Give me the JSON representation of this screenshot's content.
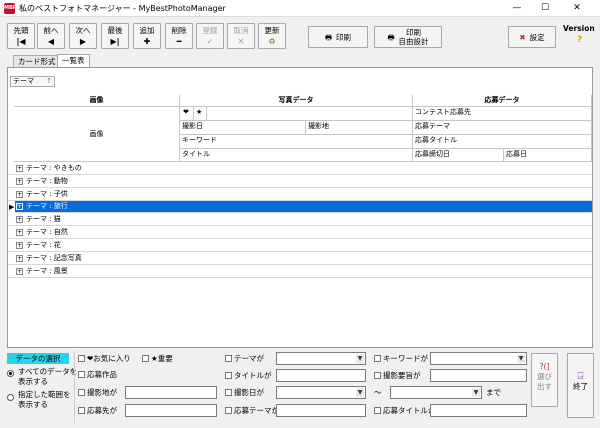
{
  "window": {
    "title": "私のベストフォトマネージャー - MyBestPhotoManager",
    "minimize": "—",
    "maximize": "☐",
    "close": "✕"
  },
  "toolbar": {
    "buttons": [
      {
        "label": "先頭",
        "icon": "|◀",
        "enabled": true
      },
      {
        "label": "前へ",
        "icon": "◀",
        "enabled": true
      },
      {
        "label": "次へ",
        "icon": "▶",
        "enabled": true
      },
      {
        "label": "最後",
        "icon": "▶|",
        "enabled": true
      },
      {
        "label": "追加",
        "icon": "✚",
        "enabled": true
      },
      {
        "label": "削除",
        "icon": "━",
        "enabled": true
      },
      {
        "label": "登録",
        "icon": "✓",
        "enabled": false
      },
      {
        "label": "取消",
        "icon": "✕",
        "enabled": false
      },
      {
        "label": "更新",
        "icon": "♻",
        "enabled": true
      }
    ],
    "print": "印刷",
    "print_custom_1": "印刷",
    "print_custom_2": "自由設計",
    "settings": "設定",
    "version": "Version",
    "version_icon": "?"
  },
  "tabs": [
    "カード形式",
    "一覧表"
  ],
  "group_by": "テーマ",
  "grid": {
    "col_image": "画像",
    "col_photo": "写真データ",
    "col_contest": "応募データ",
    "image_label": "画像",
    "heart": "❤",
    "star": "★",
    "contest_dest": "コンテスト応募先",
    "shot_date": "撮影日",
    "shot_place": "撮影地",
    "apply_theme": "応募テーマ",
    "keyword": "キーワード",
    "apply_title": "応募タイトル",
    "title": "タイトル",
    "deadline": "応募締切日",
    "apply_date": "応募日"
  },
  "rows": [
    {
      "label": "テーマ : やきもの",
      "selected": false
    },
    {
      "label": "テーマ : 動物",
      "selected": false
    },
    {
      "label": "テーマ : 子供",
      "selected": false
    },
    {
      "label": "テーマ : 旅行",
      "selected": true
    },
    {
      "label": "テーマ : 猫",
      "selected": false
    },
    {
      "label": "テーマ : 自然",
      "selected": false
    },
    {
      "label": "テーマ : 花",
      "selected": false
    },
    {
      "label": "テーマ : 記念写真",
      "selected": false
    },
    {
      "label": "テーマ : 風景",
      "selected": false
    }
  ],
  "filter": {
    "header": "データの選択",
    "radio_all_1": "すべてのデータを",
    "radio_all_2": "表示する",
    "radio_range_1": "指定した範囲を",
    "radio_range_2": "表示する",
    "fav": "❤お気に入り",
    "important": "★重要",
    "theme": "テーマが",
    "keyword": "キーワードが",
    "entry": "応募作品",
    "title": "タイトルが",
    "requirement": "撮影要旨が",
    "shot_place": "撮影地が",
    "shot_date": "撮影日が",
    "tilde": "〜",
    "until": "まで",
    "apply_to": "応募先が",
    "apply_theme": "応募テーマが",
    "apply_title": "応募タイトルが",
    "select_1": "選び",
    "select_2": "出す",
    "select_icon": "?(]",
    "exit": "終了"
  }
}
